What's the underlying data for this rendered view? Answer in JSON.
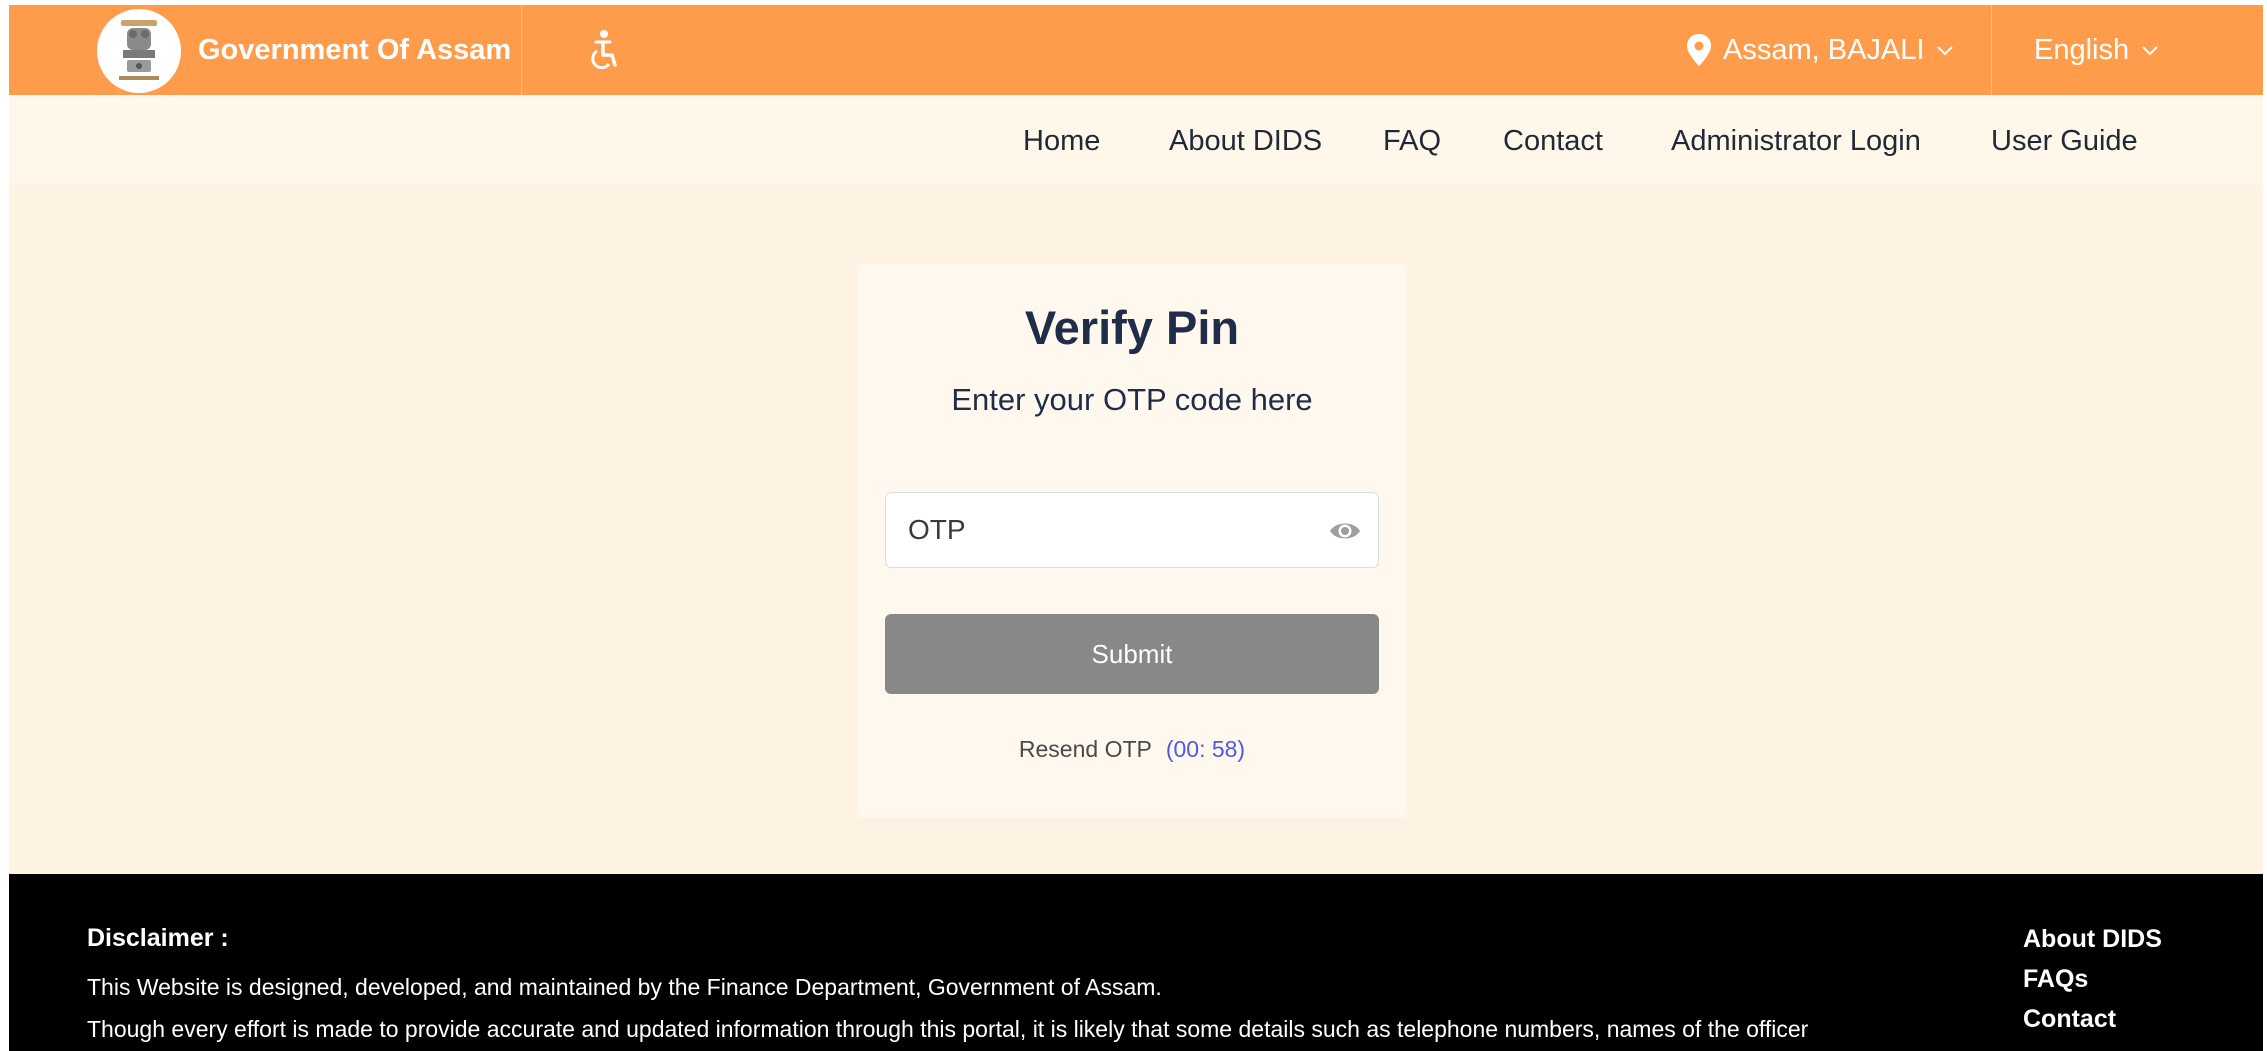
{
  "header": {
    "title": "Government Of Assam",
    "location": "Assam, BAJALI",
    "language": "English",
    "icons": {
      "emblem": "state-emblem",
      "accessibility": "accessibility-icon",
      "location": "map-pin-icon",
      "dropdown": "chevron-down-icon"
    },
    "colors": {
      "bar": "#ff9c4c",
      "text": "#ffffff"
    }
  },
  "nav": {
    "items": [
      "Home",
      "About DIDS",
      "FAQ",
      "Contact",
      "Administrator Login",
      "User Guide"
    ]
  },
  "card": {
    "title": "Verify Pin",
    "subtitle": "Enter your OTP code here",
    "otp_placeholder": "OTP",
    "otp_value": "",
    "show_password_icon": "eye-icon",
    "submit_label": "Submit",
    "resend_label": "Resend OTP",
    "timer": "(00: 58)",
    "colors": {
      "title": "#1f2d49",
      "submit_bg": "#888888",
      "timer": "#4d5ae8"
    }
  },
  "footer": {
    "disclaimer_heading": "Disclaimer :",
    "line1": "This Website is designed, developed, and maintained by the Finance Department, Government of Assam.",
    "line2": "Though every effort is made to provide accurate and updated information through this portal, it is likely that some details such as telephone numbers, names of the officer",
    "links": [
      "About DIDS",
      "FAQs",
      "Contact"
    ]
  }
}
